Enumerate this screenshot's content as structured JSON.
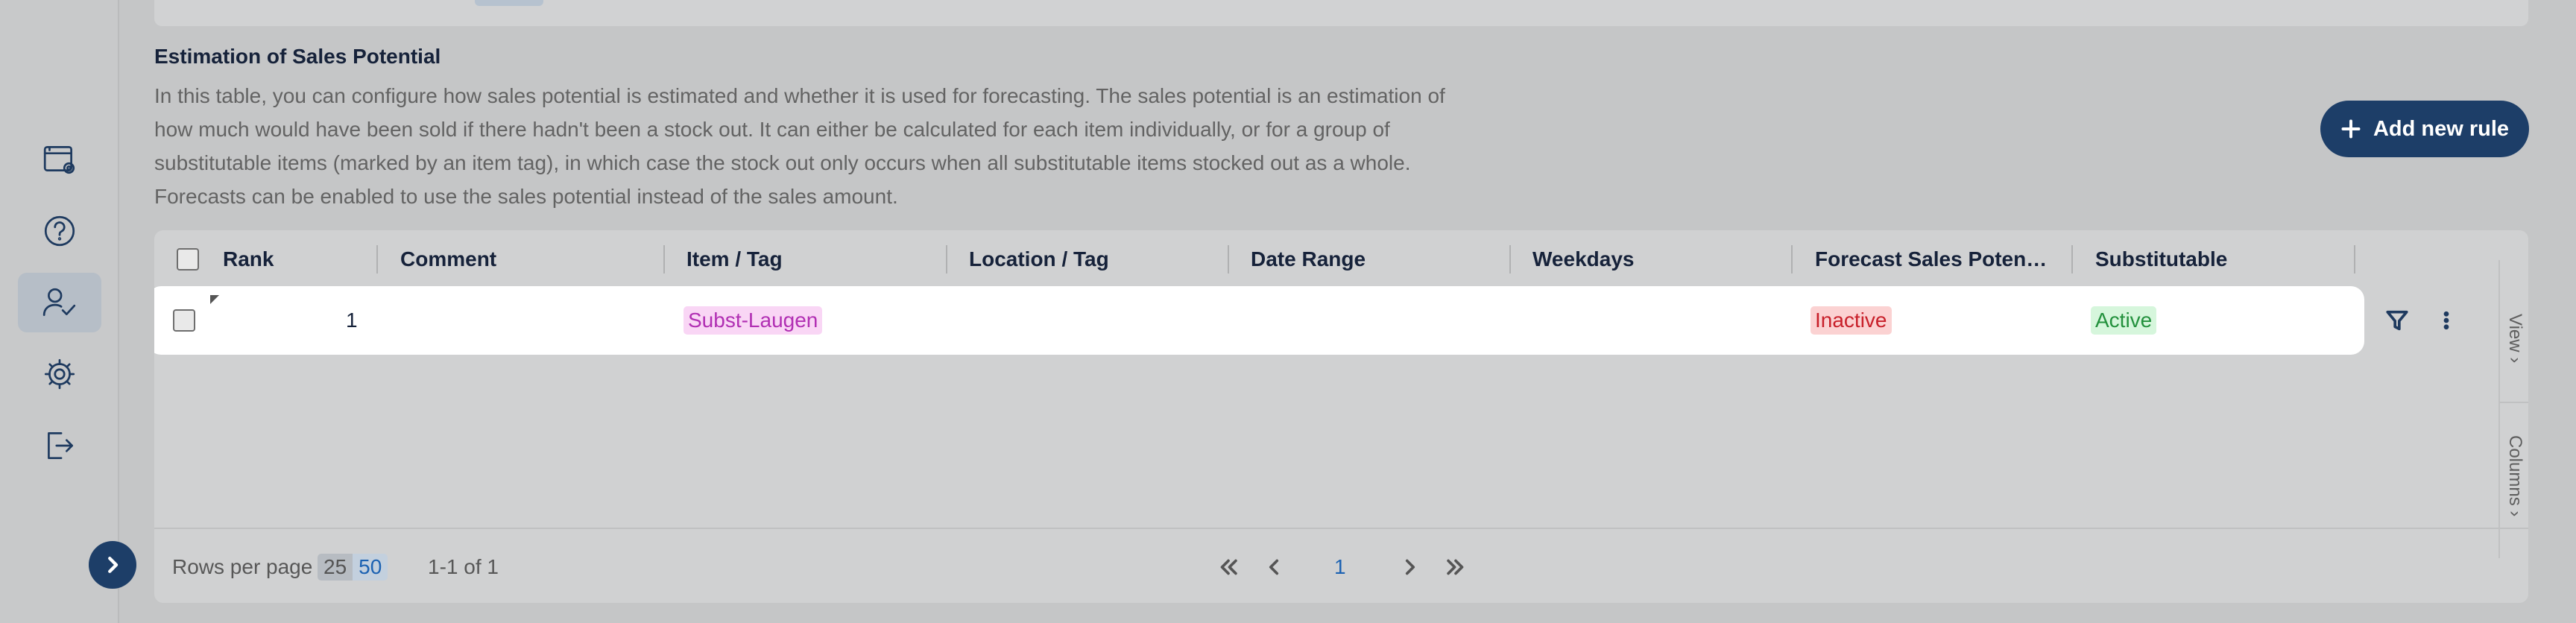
{
  "section": {
    "title": "Estimation of Sales Potential",
    "description": "In this table, you can configure how sales potential is estimated and whether it is used for forecasting. The sales potential is an estimation of how much would have been sold if there hadn't been a stock out. It can either be calculated for each item individually, or for a group of substitutable items (marked by an item tag), in which case the stock out only occurs when all substitutable items stocked out as a whole. Forecasts can be enabled to use the sales potential instead of the sales amount.",
    "add_button_label": "Add new rule"
  },
  "sidebar": {
    "items": [
      {
        "icon": "calendar-settings-icon"
      },
      {
        "icon": "help-icon"
      },
      {
        "icon": "user-check-icon",
        "active": true
      },
      {
        "icon": "gear-icon"
      },
      {
        "icon": "logout-icon"
      }
    ],
    "expand_icon": "chevron-right-icon"
  },
  "table": {
    "columns": [
      "Rank",
      "Comment",
      "Item / Tag",
      "Location / Tag",
      "Date Range",
      "Weekdays",
      "Forecast Sales Poten…",
      "Substitutable"
    ],
    "rows": [
      {
        "rank": "1",
        "comment": "",
        "item_tag": "Subst-Laugen",
        "location_tag": "",
        "date_range": "",
        "weekdays": "",
        "forecast_sales_potential": "Inactive",
        "substitutable": "Active"
      }
    ],
    "side_tabs": {
      "view": "View",
      "columns": "Columns"
    }
  },
  "pagination": {
    "rows_per_page_label": "Rows per page",
    "options": [
      "25",
      "50"
    ],
    "selected": "50",
    "range_text": "1-1 of 1",
    "current_page": "1"
  },
  "colors": {
    "primary": "#1d3e68",
    "tag_pink_text": "#b12fb3",
    "inactive_red": "#c8202a",
    "active_green": "#23913d"
  }
}
